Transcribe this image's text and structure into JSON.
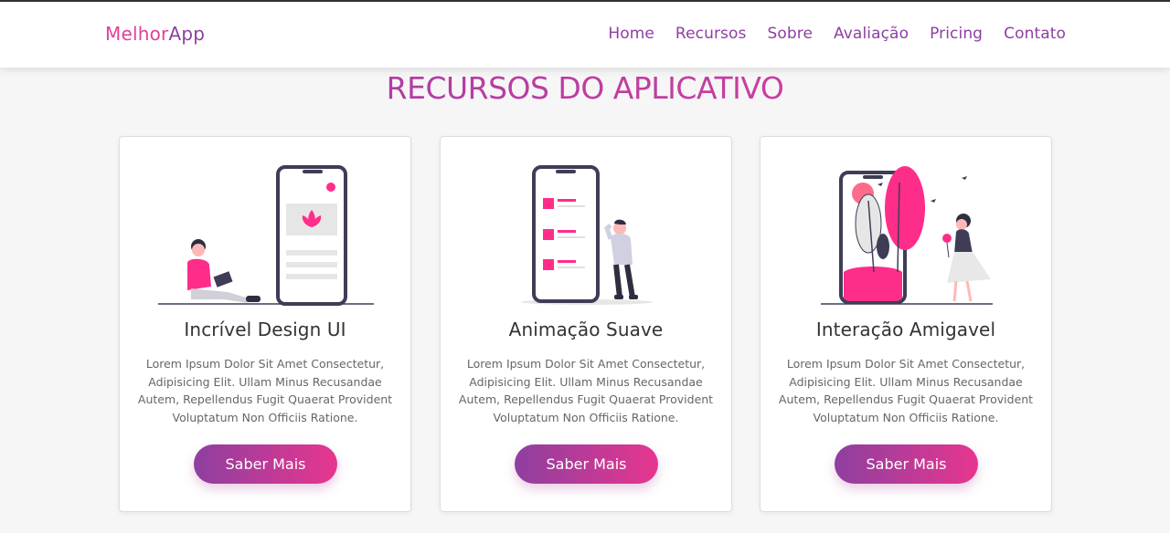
{
  "header": {
    "logo_part1": "Melhor",
    "logo_part2": "App",
    "nav": [
      "Home",
      "Recursos",
      "Sobre",
      "Avaliação",
      "Pricing",
      "Contato"
    ]
  },
  "section_title": "RECURSOS DO APLICATIVO",
  "cards": [
    {
      "title": "Incrível Design UI",
      "text": "Lorem Ipsum Dolor Sit Amet Consectetur, Adipisicing Elit. Ullam Minus Recusandae Autem, Repellendus Fugit Quaerat Provident Voluptatum Non Officiis Ratione.",
      "button": "Saber Mais"
    },
    {
      "title": "Animação Suave",
      "text": "Lorem Ipsum Dolor Sit Amet Consectetur, Adipisicing Elit. Ullam Minus Recusandae Autem, Repellendus Fugit Quaerat Provident Voluptatum Non Officiis Ratione.",
      "button": "Saber Mais"
    },
    {
      "title": "Interação Amigavel",
      "text": "Lorem Ipsum Dolor Sit Amet Consectetur, Adipisicing Elit. Ullam Minus Recusandae Autem, Repellendus Fugit Quaerat Provident Voluptatum Non Officiis Ratione.",
      "button": "Saber Mais"
    }
  ],
  "colors": {
    "accent_pink": "#e43f9a",
    "accent_purple": "#8e3fa0",
    "illustration_dark": "#3f3d56",
    "illustration_pink": "#ff2d8a"
  },
  "illustrations": [
    "person-sitting-with-phone-illustration",
    "person-thinking-with-list-phone-illustration",
    "person-with-garden-phone-illustration"
  ]
}
